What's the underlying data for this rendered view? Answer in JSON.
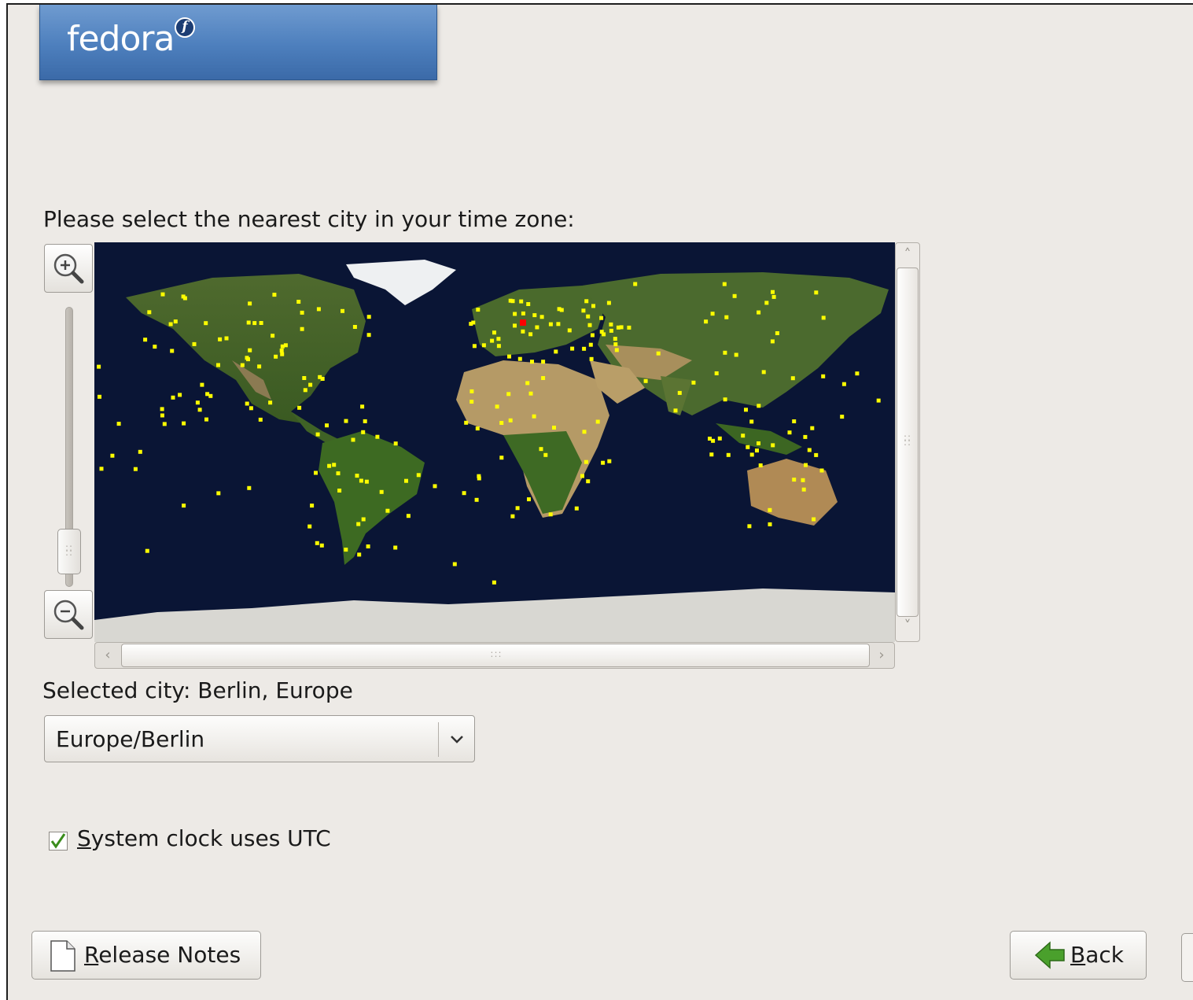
{
  "banner": {
    "logo_text": "fedora",
    "logo_mark": "f"
  },
  "timezone": {
    "prompt": "Please select the nearest city in your time zone:",
    "selected_city_label": "Selected city: Berlin, Europe",
    "combo_value": "Europe/Berlin",
    "utc_checked": true,
    "utc_label_mnemonic": "S",
    "utc_label_rest": "ystem clock uses UTC"
  },
  "map": {
    "zoom_in_icon": "zoom-in-icon",
    "zoom_out_icon": "zoom-out-icon",
    "city_marker_color": "#ffff00",
    "selected_marker_color": "#ff0000",
    "ocean_color": "#0a1535"
  },
  "buttons": {
    "release_notes_mnemonic": "R",
    "release_notes_rest": "elease Notes",
    "back_mnemonic": "B",
    "back_rest": "ack"
  },
  "colors": {
    "window_bg": "#edeae6",
    "banner_blue": "#4d7fbd",
    "check_green": "#3a8c1c",
    "back_arrow_green": "#4aa02c"
  }
}
